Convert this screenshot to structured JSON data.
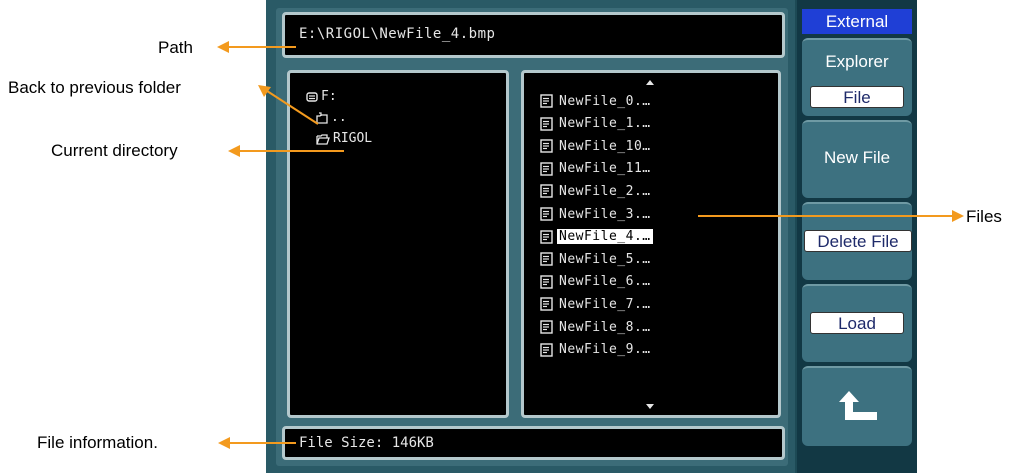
{
  "screen": {
    "path_text": "E:\\RIGOL\\NewFile_4.bmp",
    "directory_tree": [
      {
        "label": "F:",
        "icon": "drive-icon"
      },
      {
        "label": "..",
        "icon": "folder-up-icon"
      },
      {
        "label": "RIGOL",
        "icon": "open-folder-icon"
      }
    ],
    "files": [
      "NewFile_0.…",
      "NewFile_1.…",
      "NewFile_10…",
      "NewFile_11…",
      "NewFile_2.…",
      "NewFile_3.…",
      "NewFile_4.…",
      "NewFile_5.…",
      "NewFile_6.…",
      "NewFile_7.…",
      "NewFile_8.…",
      "NewFile_9.…"
    ],
    "selected_file": "NewFile_4.…",
    "file_info": "File Size: 146KB"
  },
  "menu": {
    "title": "External",
    "explorer_label": "Explorer",
    "explorer_value": "File",
    "new_file_label": "New File",
    "delete_file_label": "Delete File",
    "load_label": "Load",
    "back_icon": "return-arrow-icon"
  },
  "annotations": {
    "path": "Path",
    "back": "Back to previous folder",
    "current_dir": "Current directory",
    "files": "Files",
    "file_info": "File information."
  },
  "colors": {
    "accent_arrow": "#f39a1e",
    "menu_title_bg": "#1f3fd6",
    "panel_bg": "#000000",
    "panel_border": "#b4c8cc",
    "menu_button_bg": "#3d7180"
  }
}
